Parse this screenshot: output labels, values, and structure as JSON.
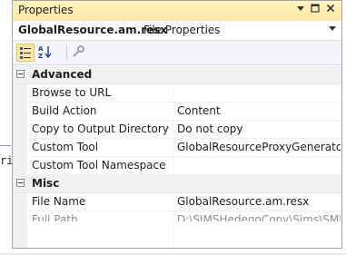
{
  "background": {
    "code_fragment": "ri"
  },
  "window": {
    "title": "Properties",
    "controls": [
      "pin-icon",
      "maximize-icon",
      "close-icon"
    ]
  },
  "object_selector": {
    "name": "GlobalResource.am.resx",
    "type": "File Properties"
  },
  "toolbar": {
    "buttons": [
      "categorized-icon",
      "alphabetical-icon",
      "property-pages-icon"
    ]
  },
  "grid": {
    "categories": [
      {
        "label": "Advanced",
        "rows": [
          {
            "name": "Browse to URL",
            "value": ""
          },
          {
            "name": "Build Action",
            "value": "Content"
          },
          {
            "name": "Copy to Output Directory",
            "value": "Do not copy"
          },
          {
            "name": "Custom Tool",
            "value": "GlobalResourceProxyGenerator"
          },
          {
            "name": "Custom Tool Namespace",
            "value": ""
          }
        ]
      },
      {
        "label": "Misc",
        "rows": [
          {
            "name": "File Name",
            "value": "GlobalResource.am.resx"
          },
          {
            "name": "Full Path",
            "value": "D:\\SIMSHedegoCopy\\Sims\\SMIS\\A"
          }
        ]
      }
    ]
  },
  "colors": {
    "title_bar": "#ffe8a6",
    "category_background": "#f0f0f0",
    "readonly_text": "#8d8d8d"
  }
}
